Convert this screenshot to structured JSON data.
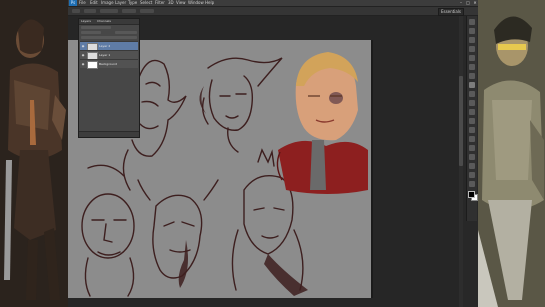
{
  "app": {
    "logo_text": "Ps",
    "menus": [
      "File",
      "Edit",
      "Image",
      "Layer",
      "Type",
      "Select",
      "Filter",
      "3D",
      "View",
      "Window",
      "Help"
    ],
    "workspace": "Essentials",
    "window_controls": [
      "–",
      "□",
      "✕"
    ]
  },
  "layers_panel": {
    "tabs": [
      "Layers",
      "Channels"
    ],
    "layers": [
      {
        "name": "Layer 2",
        "active": true,
        "visible": true
      },
      {
        "name": "Layer 1",
        "active": false,
        "visible": true
      },
      {
        "name": "Background",
        "active": false,
        "visible": true
      }
    ]
  },
  "colors": {
    "canvas": "#8c8c8c",
    "sketch_ink": "#3d1f1f",
    "accent_layer": "#5f7ca6"
  },
  "icons": [
    "ps-logo-icon",
    "eye-icon",
    "move-tool-icon",
    "brush-tool-icon",
    "eraser-tool-icon",
    "zoom-tool-icon",
    "foreground-color-swatch",
    "background-color-swatch"
  ]
}
